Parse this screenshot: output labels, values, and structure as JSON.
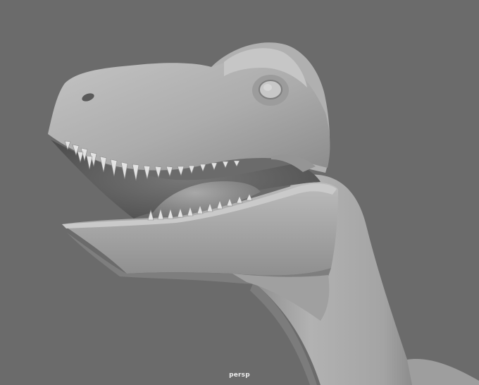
{
  "viewport": {
    "camera_name": "persp",
    "background_color": "#6b6b6b",
    "shading": "smooth-shaded",
    "object": "dinosaur-head-model"
  },
  "colors": {
    "model_light": "#b9b9b9",
    "model_mid": "#9a9a9a",
    "model_dark": "#7a7a7a",
    "mouth_interior": "#5c5c5c",
    "teeth": "#e2e2e2",
    "label_text": "#ececec"
  }
}
